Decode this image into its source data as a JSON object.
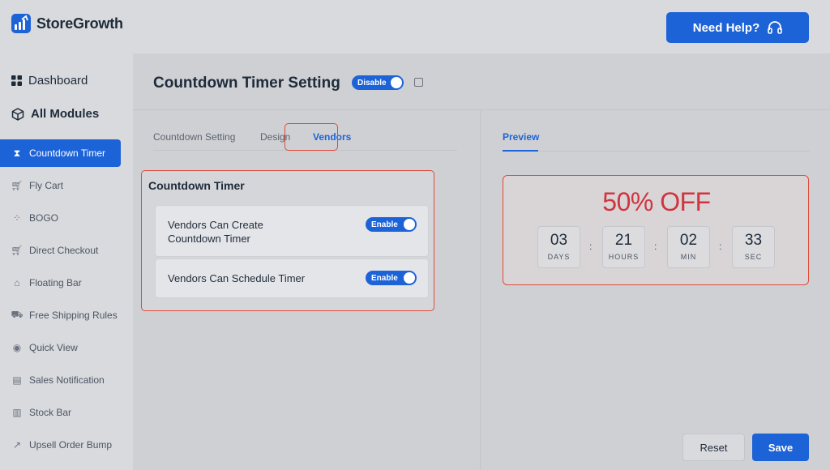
{
  "brand": {
    "name": "StoreGrowth"
  },
  "header": {
    "help_label": "Need Help?",
    "help_icon": "headphones-icon"
  },
  "sidebar": {
    "dashboard": {
      "label": "Dashboard",
      "icon": "grid-icon"
    },
    "all_modules": {
      "label": "All Modules",
      "icon": "cube-icon"
    },
    "items": [
      {
        "label": "Countdown Timer",
        "icon": "hourglass-icon",
        "active": true
      },
      {
        "label": "Fly Cart",
        "icon": "cart-icon"
      },
      {
        "label": "BOGO",
        "icon": "bogo-icon"
      },
      {
        "label": "Direct Checkout",
        "icon": "checkout-icon"
      },
      {
        "label": "Floating Bar",
        "icon": "tag-icon"
      },
      {
        "label": "Free Shipping Rules",
        "icon": "truck-icon"
      },
      {
        "label": "Quick View",
        "icon": "eye-icon"
      },
      {
        "label": "Sales Notification",
        "icon": "notification-icon"
      },
      {
        "label": "Stock Bar",
        "icon": "bar-chart-icon"
      },
      {
        "label": "Upsell Order Bump",
        "icon": "trend-icon"
      }
    ]
  },
  "page": {
    "title": "Countdown Timer Setting",
    "module_toggle": "Disable",
    "tabs": [
      "Countdown Setting",
      "Design",
      "Vendors"
    ],
    "active_tab": "Vendors",
    "preview_tab": "Preview"
  },
  "settings": {
    "section_title": "Countdown Timer",
    "options": [
      {
        "label_line1": "Vendors Can Create",
        "label_line2": "Countdown Timer",
        "toggle": "Enable"
      },
      {
        "label_line1": "Vendors Can Schedule Timer",
        "label_line2": "",
        "toggle": "Enable"
      }
    ]
  },
  "preview": {
    "offer": "50% OFF",
    "units": [
      {
        "value": "03",
        "label": "DAYS"
      },
      {
        "value": "21",
        "label": "HOURS"
      },
      {
        "value": "02",
        "label": "MIN"
      },
      {
        "value": "33",
        "label": "SEC"
      }
    ],
    "separator": ":"
  },
  "actions": {
    "reset": "Reset",
    "save": "Save"
  },
  "colors": {
    "accent": "#1d63d8",
    "highlight": "#e04a3a",
    "offer": "#d0343f"
  }
}
